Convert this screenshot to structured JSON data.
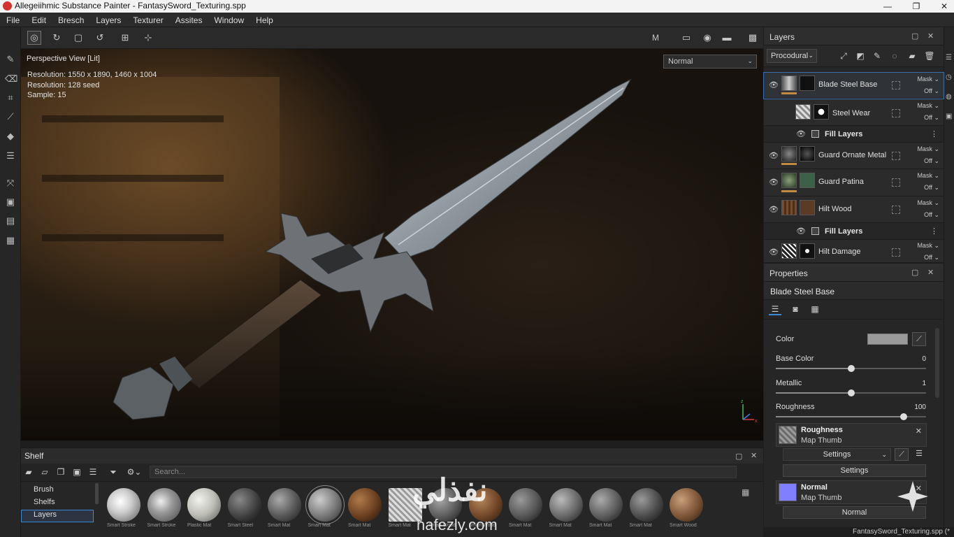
{
  "window": {
    "title": "Allegeiihmic Substance Painter - FantasySword_Texturing.spp",
    "min": "—",
    "max": "❐",
    "close": "✕"
  },
  "menu": [
    "File",
    "Edit",
    "Bresch",
    "Layers",
    "Texturer",
    "Assites",
    "Window",
    "Help"
  ],
  "viewport": {
    "view_name": "Perspective View [Lit]",
    "info": [
      "Resolution: 1550 x 1890, 1460 x 1004",
      "Resolution: 128 seed",
      "Sample: 15"
    ],
    "mode_select": "Normal",
    "m_button": "M"
  },
  "layers_panel": {
    "title": "Layers",
    "channel_select": "Procodural",
    "layers": [
      {
        "name": "Blade Steel Base",
        "mask": "Mask",
        "off": "Off"
      },
      {
        "name": "Steel Wear",
        "mask": "Mask",
        "off": "Off"
      },
      {
        "name": "Fill Layers"
      },
      {
        "name": "Guard Ornate Metal",
        "mask": "Mask",
        "off": "Off"
      },
      {
        "name": "Guard Patina",
        "mask": "Mask",
        "off": "Off"
      },
      {
        "name": "Hilt Wood",
        "mask": "Mask",
        "off": "Off"
      },
      {
        "name": "Fill Layers"
      },
      {
        "name": "Hilt Damage",
        "mask": "Mask",
        "off": "Off"
      }
    ]
  },
  "properties": {
    "title": "Properties",
    "layer_name": "Blade Steel Base",
    "color_label": "Color",
    "base_color": {
      "label": "Base Color",
      "value": "0",
      "fraction": 0.5
    },
    "metallic": {
      "label": "Metallic",
      "value": "1",
      "fraction": 0.5
    },
    "roughness": {
      "label": "Roughness",
      "value": "100",
      "fraction": 0.85
    },
    "roughness_map": {
      "title": "Roughness",
      "sub": "Map Thumb"
    },
    "settings_select": "Settings",
    "settings_button": "Settings",
    "normal_map": {
      "title": "Normal",
      "sub": "Map Thumb"
    },
    "normal_button": "Normal"
  },
  "shelf": {
    "title": "Shelf",
    "search_placeholder": "Search...",
    "categories": [
      "Brush",
      "Shelfs",
      "Layers"
    ],
    "items": [
      "Smart Stroke",
      "Smart Stroke",
      "Plastic Mat",
      "Smart Steel",
      "Smart Mat",
      "Smart Mat",
      "Smart Mat",
      "Smart Mat",
      "Smart Wood",
      "Smart Wood",
      "Smart Mat",
      "Smart Mat",
      "Smart Mat",
      "Smart Mat",
      "Smart Wood"
    ]
  },
  "status": {
    "file": "FantasySword_Texturing.spp (*"
  },
  "watermark": {
    "arabic": "نفذلي",
    "site": "nafezly.com"
  }
}
